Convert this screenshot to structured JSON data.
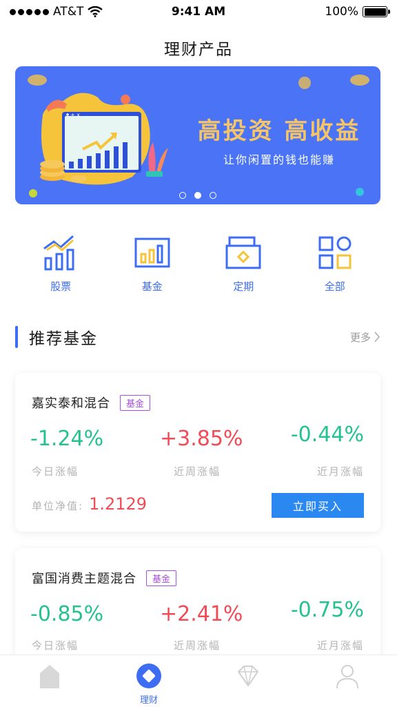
{
  "status": {
    "carrier": "AT&T",
    "time": "9:41 AM",
    "battery": "100%"
  },
  "header": {
    "title": "理财产品"
  },
  "banner": {
    "headline": "高投资 高收益",
    "subtitle": "让你闲置的钱也能赚",
    "slides": 3,
    "active_slide": 2
  },
  "categories": [
    {
      "label": "股票",
      "icon": "stock-chart-icon"
    },
    {
      "label": "基金",
      "icon": "fund-chart-icon"
    },
    {
      "label": "定期",
      "icon": "deposit-box-icon"
    },
    {
      "label": "全部",
      "icon": "grid-all-icon"
    }
  ],
  "section": {
    "title": "推荐基金",
    "more": "更多"
  },
  "funds": [
    {
      "name": "嘉实泰和混合",
      "tag": "基金",
      "day_change": "-1.24%",
      "week_change": "+3.85%",
      "month_change": "-0.44%",
      "day_label": "今日涨幅",
      "week_label": "近周涨幅",
      "month_label": "近月涨幅",
      "nav_label": "单位净值:",
      "nav_value": "1.2129",
      "buy_label": "立即买入"
    },
    {
      "name": "富国消费主题混合",
      "tag": "基金",
      "day_change": "-0.85%",
      "week_change": "+2.41%",
      "month_change": "-0.75%",
      "day_label": "今日涨幅",
      "week_label": "近周涨幅",
      "month_label": "近月涨幅"
    }
  ],
  "tabbar": [
    {
      "label": "",
      "icon": "home-icon"
    },
    {
      "label": "理财",
      "icon": "finance-diamond-icon",
      "active": true
    },
    {
      "label": "",
      "icon": "gem-icon"
    },
    {
      "label": "",
      "icon": "user-icon"
    }
  ],
  "colors": {
    "accent": "#3d6df2",
    "banner": "#4a74f5",
    "gain": "#ef4c57",
    "loss": "#25c28f",
    "tag": "#a44fe0",
    "buy_button": "#2b88f0"
  }
}
